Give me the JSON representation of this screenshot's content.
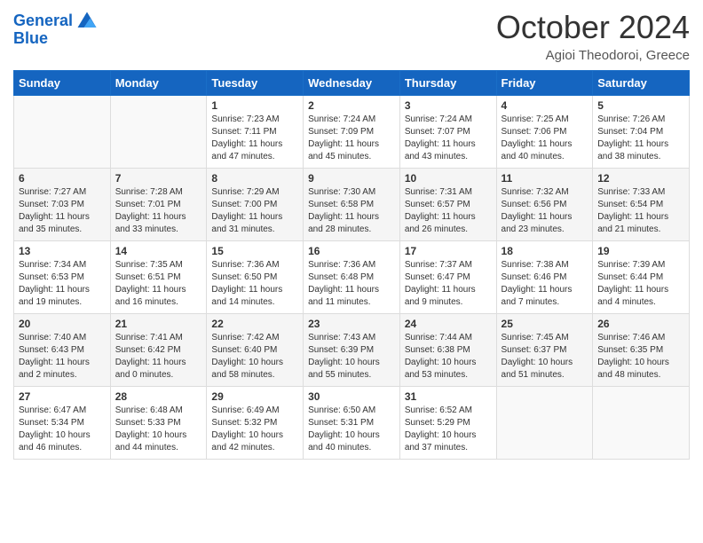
{
  "header": {
    "logo_line1": "General",
    "logo_line2": "Blue",
    "month": "October 2024",
    "location": "Agioi Theodoroi, Greece"
  },
  "weekdays": [
    "Sunday",
    "Monday",
    "Tuesday",
    "Wednesday",
    "Thursday",
    "Friday",
    "Saturday"
  ],
  "weeks": [
    [
      {
        "day": "",
        "sunrise": "",
        "sunset": "",
        "daylight": ""
      },
      {
        "day": "",
        "sunrise": "",
        "sunset": "",
        "daylight": ""
      },
      {
        "day": "1",
        "sunrise": "Sunrise: 7:23 AM",
        "sunset": "Sunset: 7:11 PM",
        "daylight": "Daylight: 11 hours and 47 minutes."
      },
      {
        "day": "2",
        "sunrise": "Sunrise: 7:24 AM",
        "sunset": "Sunset: 7:09 PM",
        "daylight": "Daylight: 11 hours and 45 minutes."
      },
      {
        "day": "3",
        "sunrise": "Sunrise: 7:24 AM",
        "sunset": "Sunset: 7:07 PM",
        "daylight": "Daylight: 11 hours and 43 minutes."
      },
      {
        "day": "4",
        "sunrise": "Sunrise: 7:25 AM",
        "sunset": "Sunset: 7:06 PM",
        "daylight": "Daylight: 11 hours and 40 minutes."
      },
      {
        "day": "5",
        "sunrise": "Sunrise: 7:26 AM",
        "sunset": "Sunset: 7:04 PM",
        "daylight": "Daylight: 11 hours and 38 minutes."
      }
    ],
    [
      {
        "day": "6",
        "sunrise": "Sunrise: 7:27 AM",
        "sunset": "Sunset: 7:03 PM",
        "daylight": "Daylight: 11 hours and 35 minutes."
      },
      {
        "day": "7",
        "sunrise": "Sunrise: 7:28 AM",
        "sunset": "Sunset: 7:01 PM",
        "daylight": "Daylight: 11 hours and 33 minutes."
      },
      {
        "day": "8",
        "sunrise": "Sunrise: 7:29 AM",
        "sunset": "Sunset: 7:00 PM",
        "daylight": "Daylight: 11 hours and 31 minutes."
      },
      {
        "day": "9",
        "sunrise": "Sunrise: 7:30 AM",
        "sunset": "Sunset: 6:58 PM",
        "daylight": "Daylight: 11 hours and 28 minutes."
      },
      {
        "day": "10",
        "sunrise": "Sunrise: 7:31 AM",
        "sunset": "Sunset: 6:57 PM",
        "daylight": "Daylight: 11 hours and 26 minutes."
      },
      {
        "day": "11",
        "sunrise": "Sunrise: 7:32 AM",
        "sunset": "Sunset: 6:56 PM",
        "daylight": "Daylight: 11 hours and 23 minutes."
      },
      {
        "day": "12",
        "sunrise": "Sunrise: 7:33 AM",
        "sunset": "Sunset: 6:54 PM",
        "daylight": "Daylight: 11 hours and 21 minutes."
      }
    ],
    [
      {
        "day": "13",
        "sunrise": "Sunrise: 7:34 AM",
        "sunset": "Sunset: 6:53 PM",
        "daylight": "Daylight: 11 hours and 19 minutes."
      },
      {
        "day": "14",
        "sunrise": "Sunrise: 7:35 AM",
        "sunset": "Sunset: 6:51 PM",
        "daylight": "Daylight: 11 hours and 16 minutes."
      },
      {
        "day": "15",
        "sunrise": "Sunrise: 7:36 AM",
        "sunset": "Sunset: 6:50 PM",
        "daylight": "Daylight: 11 hours and 14 minutes."
      },
      {
        "day": "16",
        "sunrise": "Sunrise: 7:36 AM",
        "sunset": "Sunset: 6:48 PM",
        "daylight": "Daylight: 11 hours and 11 minutes."
      },
      {
        "day": "17",
        "sunrise": "Sunrise: 7:37 AM",
        "sunset": "Sunset: 6:47 PM",
        "daylight": "Daylight: 11 hours and 9 minutes."
      },
      {
        "day": "18",
        "sunrise": "Sunrise: 7:38 AM",
        "sunset": "Sunset: 6:46 PM",
        "daylight": "Daylight: 11 hours and 7 minutes."
      },
      {
        "day": "19",
        "sunrise": "Sunrise: 7:39 AM",
        "sunset": "Sunset: 6:44 PM",
        "daylight": "Daylight: 11 hours and 4 minutes."
      }
    ],
    [
      {
        "day": "20",
        "sunrise": "Sunrise: 7:40 AM",
        "sunset": "Sunset: 6:43 PM",
        "daylight": "Daylight: 11 hours and 2 minutes."
      },
      {
        "day": "21",
        "sunrise": "Sunrise: 7:41 AM",
        "sunset": "Sunset: 6:42 PM",
        "daylight": "Daylight: 11 hours and 0 minutes."
      },
      {
        "day": "22",
        "sunrise": "Sunrise: 7:42 AM",
        "sunset": "Sunset: 6:40 PM",
        "daylight": "Daylight: 10 hours and 58 minutes."
      },
      {
        "day": "23",
        "sunrise": "Sunrise: 7:43 AM",
        "sunset": "Sunset: 6:39 PM",
        "daylight": "Daylight: 10 hours and 55 minutes."
      },
      {
        "day": "24",
        "sunrise": "Sunrise: 7:44 AM",
        "sunset": "Sunset: 6:38 PM",
        "daylight": "Daylight: 10 hours and 53 minutes."
      },
      {
        "day": "25",
        "sunrise": "Sunrise: 7:45 AM",
        "sunset": "Sunset: 6:37 PM",
        "daylight": "Daylight: 10 hours and 51 minutes."
      },
      {
        "day": "26",
        "sunrise": "Sunrise: 7:46 AM",
        "sunset": "Sunset: 6:35 PM",
        "daylight": "Daylight: 10 hours and 48 minutes."
      }
    ],
    [
      {
        "day": "27",
        "sunrise": "Sunrise: 6:47 AM",
        "sunset": "Sunset: 5:34 PM",
        "daylight": "Daylight: 10 hours and 46 minutes."
      },
      {
        "day": "28",
        "sunrise": "Sunrise: 6:48 AM",
        "sunset": "Sunset: 5:33 PM",
        "daylight": "Daylight: 10 hours and 44 minutes."
      },
      {
        "day": "29",
        "sunrise": "Sunrise: 6:49 AM",
        "sunset": "Sunset: 5:32 PM",
        "daylight": "Daylight: 10 hours and 42 minutes."
      },
      {
        "day": "30",
        "sunrise": "Sunrise: 6:50 AM",
        "sunset": "Sunset: 5:31 PM",
        "daylight": "Daylight: 10 hours and 40 minutes."
      },
      {
        "day": "31",
        "sunrise": "Sunrise: 6:52 AM",
        "sunset": "Sunset: 5:29 PM",
        "daylight": "Daylight: 10 hours and 37 minutes."
      },
      {
        "day": "",
        "sunrise": "",
        "sunset": "",
        "daylight": ""
      },
      {
        "day": "",
        "sunrise": "",
        "sunset": "",
        "daylight": ""
      }
    ]
  ]
}
